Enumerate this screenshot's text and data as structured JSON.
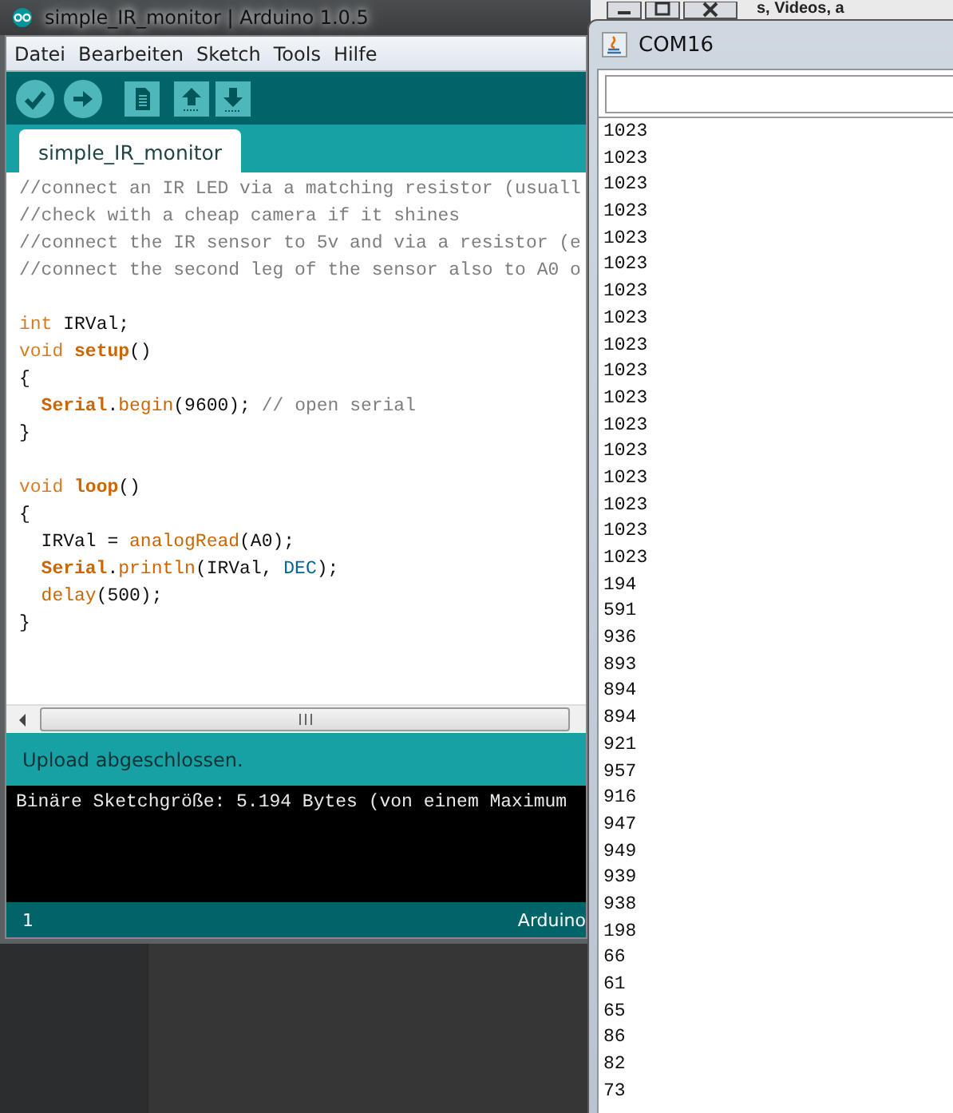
{
  "background_window": {
    "heading": "s, Videos, a"
  },
  "ide": {
    "title": "simple_IR_monitor | Arduino 1.0.5",
    "menu": [
      "Datei",
      "Bearbeiten",
      "Sketch",
      "Tools",
      "Hilfe"
    ],
    "tabs": [
      {
        "label": "simple_IR_monitor",
        "selected": true
      }
    ],
    "code_lines": [
      {
        "kind": "code",
        "segments": [
          {
            "kind": "comment",
            "text": "//connect an IR LED via a matching resistor (usuall"
          }
        ]
      },
      {
        "kind": "code",
        "segments": [
          {
            "kind": "comment",
            "text": "//check with a cheap camera if it shines"
          }
        ]
      },
      {
        "kind": "code",
        "segments": [
          {
            "kind": "comment",
            "text": "//connect the IR sensor to 5v and via a resistor (e"
          }
        ]
      },
      {
        "kind": "code",
        "segments": [
          {
            "kind": "comment",
            "text": "//connect the second leg of the sensor also to A0 o"
          }
        ]
      },
      {
        "kind": "blank"
      },
      {
        "kind": "code",
        "segments": [
          {
            "kind": "type",
            "text": "int"
          },
          {
            "kind": "plain",
            "text": " IRVal;"
          }
        ]
      },
      {
        "kind": "code",
        "segments": [
          {
            "kind": "type",
            "text": "void "
          },
          {
            "kind": "bold_function",
            "text": "setup"
          },
          {
            "kind": "plain",
            "text": "()"
          }
        ]
      },
      {
        "kind": "code",
        "segments": [
          {
            "kind": "plain",
            "text": "{"
          }
        ]
      },
      {
        "kind": "code",
        "segments": [
          {
            "kind": "bold_function",
            "text": "  Serial"
          },
          {
            "kind": "plain",
            "text": "."
          },
          {
            "kind": "function",
            "text": "begin"
          },
          {
            "kind": "plain",
            "text": "(9600); "
          },
          {
            "kind": "comment",
            "text": "// open serial"
          }
        ]
      },
      {
        "kind": "code",
        "segments": [
          {
            "kind": "plain",
            "text": "}"
          }
        ]
      },
      {
        "kind": "blank"
      },
      {
        "kind": "code",
        "segments": [
          {
            "kind": "type",
            "text": "void "
          },
          {
            "kind": "bold_function",
            "text": "loop"
          },
          {
            "kind": "plain",
            "text": "()"
          }
        ]
      },
      {
        "kind": "code",
        "segments": [
          {
            "kind": "plain",
            "text": "{"
          }
        ]
      },
      {
        "kind": "code",
        "segments": [
          {
            "kind": "plain",
            "text": "  IRVal = "
          },
          {
            "kind": "function",
            "text": "analogRead"
          },
          {
            "kind": "plain",
            "text": "(A0);"
          }
        ]
      },
      {
        "kind": "code",
        "segments": [
          {
            "kind": "bold_function",
            "text": "  Serial"
          },
          {
            "kind": "plain",
            "text": "."
          },
          {
            "kind": "function",
            "text": "println"
          },
          {
            "kind": "plain",
            "text": "(IRVal, "
          },
          {
            "kind": "constant",
            "text": "DEC"
          },
          {
            "kind": "plain",
            "text": ");"
          }
        ]
      },
      {
        "kind": "code",
        "segments": [
          {
            "kind": "function",
            "text": "  delay"
          },
          {
            "kind": "plain",
            "text": "(500);"
          }
        ]
      },
      {
        "kind": "code",
        "segments": [
          {
            "kind": "plain",
            "text": "}"
          }
        ]
      }
    ],
    "status_message": "Upload abgeschlossen.",
    "console_lines": [
      "Binäre Sketchgröße: 5.194 Bytes (von einem Maximum"
    ],
    "footer": {
      "line_number": "1",
      "board": "Arduino"
    }
  },
  "serial_monitor": {
    "title": "COM16",
    "output": [
      "1023",
      "1023",
      "1023",
      "1023",
      "1023",
      "1023",
      "1023",
      "1023",
      "1023",
      "1023",
      "1023",
      "1023",
      "1023",
      "1023",
      "1023",
      "1023",
      "1023",
      "194",
      "591",
      "936",
      "893",
      "894",
      "894",
      "921",
      "957",
      "916",
      "947",
      "949",
      "939",
      "938",
      "198",
      "66",
      "61",
      "65",
      "86",
      "82",
      "73"
    ]
  }
}
